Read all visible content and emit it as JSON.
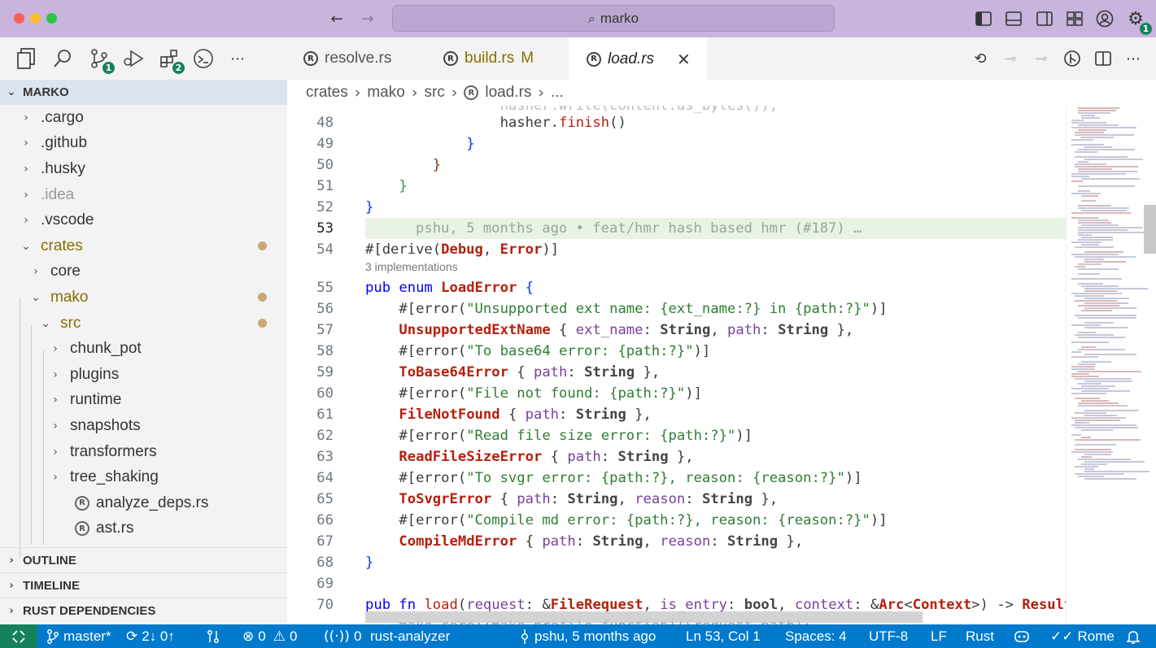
{
  "window": {
    "search_text": "marko"
  },
  "activity": {
    "source_control_badge": "1",
    "extensions_badge": "2"
  },
  "explorer": {
    "root_label": "MARKO",
    "items": [
      {
        "label": ".cargo",
        "depth": 1,
        "expanded": false
      },
      {
        "label": ".github",
        "depth": 1,
        "expanded": false
      },
      {
        "label": ".husky",
        "depth": 1,
        "expanded": false
      },
      {
        "label": ".idea",
        "depth": 1,
        "expanded": false
      },
      {
        "label": ".vscode",
        "depth": 1,
        "expanded": false
      },
      {
        "label": "crates",
        "depth": 1,
        "expanded": true
      },
      {
        "label": "core",
        "depth": 2,
        "expanded": false
      },
      {
        "label": "mako",
        "depth": 2,
        "expanded": true
      },
      {
        "label": "src",
        "depth": 3,
        "expanded": true
      },
      {
        "label": "chunk_pot",
        "depth": 4,
        "expanded": false
      },
      {
        "label": "plugins",
        "depth": 4,
        "expanded": false
      },
      {
        "label": "runtime",
        "depth": 4,
        "expanded": false
      },
      {
        "label": "snapshots",
        "depth": 4,
        "expanded": false
      },
      {
        "label": "transformers",
        "depth": 4,
        "expanded": false
      },
      {
        "label": "tree_shaking",
        "depth": 4,
        "expanded": false
      },
      {
        "label": "analyze_deps.rs",
        "depth": 4,
        "file": true
      },
      {
        "label": "ast.rs",
        "depth": 4,
        "file": true
      }
    ],
    "outline_label": "OUTLINE",
    "timeline_label": "TIMELINE",
    "rust_deps_label": "RUST DEPENDENCIES"
  },
  "tabs": [
    {
      "label": "resolve.rs",
      "suffix": ""
    },
    {
      "label": "build.rs",
      "suffix": "M"
    },
    {
      "label": "load.rs",
      "suffix": ""
    }
  ],
  "breadcrumb": {
    "p1": "crates",
    "p2": "mako",
    "p3": "src",
    "p4": "load.rs",
    "p5": "..."
  },
  "editor": {
    "lens_text": "3 implementations",
    "blame_text": "pshu, 5 months ago • feat/hmr hash based hmr (#187) …",
    "line_numbers": [
      "48",
      "49",
      "50",
      "51",
      "52",
      "53",
      "54",
      "55",
      "56",
      "57",
      "58",
      "59",
      "60",
      "61",
      "62",
      "63",
      "64",
      "65",
      "66",
      "67",
      "68",
      "69",
      "70"
    ]
  },
  "status": {
    "branch": "master*",
    "sync": "2↓ 0↑",
    "errors": "0",
    "warnings": "0",
    "ports": "0",
    "analyzer": "rust-analyzer",
    "blame": "pshu, 5 months ago",
    "position": "Ln 53, Col 1",
    "spaces": "Spaces: 4",
    "encoding": "UTF-8",
    "eol": "LF",
    "language": "Rust",
    "theme": "Rome"
  },
  "colors": {
    "status_bar": "#007acc",
    "remote": "#16825d",
    "title_bar": "#c8b4dc",
    "current_line": "#e8f3e6"
  }
}
